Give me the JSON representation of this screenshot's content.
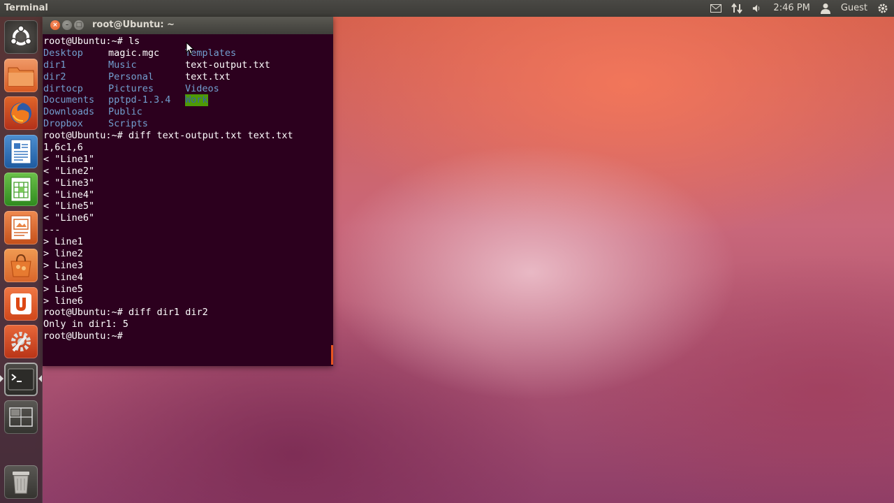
{
  "top_panel": {
    "app_title": "Terminal",
    "time": "2:46 PM",
    "user": "Guest",
    "icons": [
      "mail-icon",
      "network-icon",
      "volume-icon",
      "user-icon",
      "gear-icon"
    ]
  },
  "launcher": {
    "items": [
      {
        "name": "dash-home",
        "icon": "ubuntu-logo-icon"
      },
      {
        "name": "home-folder",
        "icon": "folder-icon"
      },
      {
        "name": "firefox",
        "icon": "firefox-icon"
      },
      {
        "name": "libreoffice-writer",
        "icon": "writer-icon"
      },
      {
        "name": "libreoffice-calc",
        "icon": "calc-icon"
      },
      {
        "name": "libreoffice-impress",
        "icon": "impress-icon"
      },
      {
        "name": "software-center",
        "icon": "shopping-bag-icon"
      },
      {
        "name": "ubuntu-one",
        "icon": "ubuntu-one-icon",
        "label": "U"
      },
      {
        "name": "system-settings",
        "icon": "settings-icon"
      },
      {
        "name": "terminal",
        "icon": "terminal-icon",
        "label": ">_"
      },
      {
        "name": "workspace-switcher",
        "icon": "workspace-icon"
      },
      {
        "name": "trash",
        "icon": "trash-icon"
      }
    ]
  },
  "terminal": {
    "title": "root@Ubuntu: ~",
    "buttons": {
      "close": "×",
      "minimize": "–",
      "maximize": "□"
    },
    "ls_prompt": "root@Ubuntu:~# ls",
    "ls_rows": [
      [
        "Desktop",
        "magic.mgc",
        "Templates"
      ],
      [
        "dir1",
        "Music",
        "text-output.txt"
      ],
      [
        "dir2",
        "Personal",
        "text.txt"
      ],
      [
        "dirtocp",
        "Pictures",
        "Videos"
      ],
      [
        "Documents",
        "pptpd-1.3.4",
        "Work"
      ],
      [
        "Downloads",
        "Public",
        ""
      ],
      [
        "Dropbox",
        "Scripts",
        ""
      ]
    ],
    "after_ls_lines": [
      "root@Ubuntu:~# diff text-output.txt text.txt",
      "1,6c1,6",
      "< \"Line1\"",
      "< \"Line2\"",
      "< \"Line3\"",
      "< \"Line4\"",
      "< \"Line5\"",
      "< \"Line6\"",
      "---",
      "> Line1",
      "> line2",
      "> Line3",
      "> line4",
      "> Line5",
      "> line6",
      "root@Ubuntu:~# diff dir1 dir2",
      "Only in dir1: 5",
      "root@Ubuntu:~#"
    ]
  },
  "colors": {
    "terminal_bg": "#2c001e",
    "directory": "#729fcf",
    "highlight_bg": "#4e9a06",
    "accent": "#e95420"
  }
}
